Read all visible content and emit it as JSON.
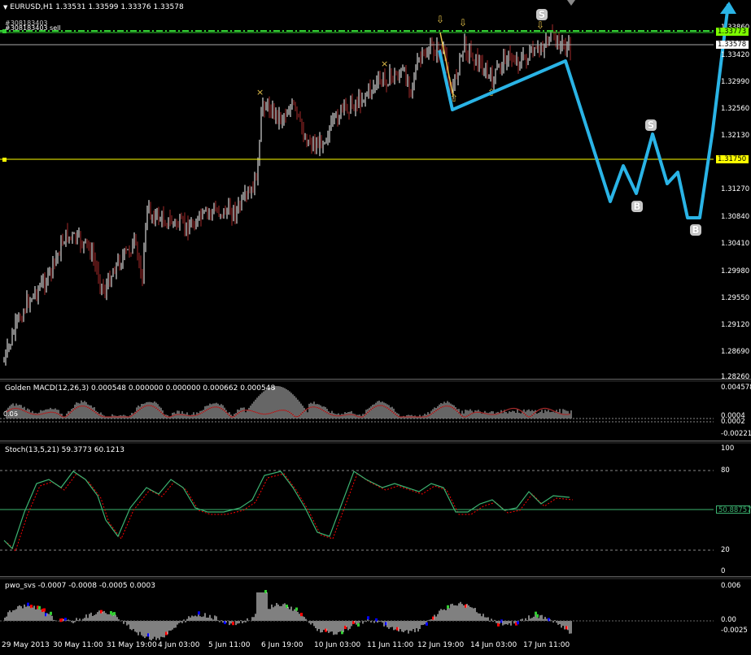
{
  "main": {
    "header": "EURUSD,H1  1.33531 1.33599 1.33376 1.33578",
    "order_label": "#308183403 sell",
    "order_label2": "#308183403",
    "price_ticks": [
      "1.33860",
      "1.33578",
      "1.33420",
      "1.32990",
      "1.32560",
      "1.32130",
      "1.31750",
      "1.31270",
      "1.30840",
      "1.30410",
      "1.29980",
      "1.29550",
      "1.29120",
      "1.28690",
      "1.28260"
    ],
    "order_price": "1.33773",
    "current_price": "1.33578",
    "line_price": "1.31750",
    "pattern_labels": [
      "S",
      "S",
      "B",
      "B"
    ]
  },
  "macd": {
    "header": "Golden MACD(12,26,3) 0.000548 0.000000 0.000000 0.000662 0.000548",
    "ticks": [
      "0.004578",
      "0.0004",
      "0.0002",
      "-0.002211"
    ],
    "left_label": "0.06"
  },
  "stoch": {
    "header": "Stoch(13,5,21) 59.3773 60.1213",
    "ticks": [
      "100",
      "80",
      "20",
      "0"
    ],
    "current": "50.88757"
  },
  "pwo": {
    "header": "pwo_svs -0.0007 -0.0008 -0.0005 0.0003",
    "ticks": [
      "0.006",
      "0.00",
      "-0.0025"
    ]
  },
  "time_axis": [
    "29 May 2013",
    "30 May 11:00",
    "31 May 19:00",
    "4 Jun 03:00",
    "5 Jun 11:00",
    "6 Jun 19:00",
    "10 Jun 03:00",
    "11 Jun 11:00",
    "12 Jun 19:00",
    "14 Jun 03:00",
    "17 Jun 11:00"
  ],
  "colors": {
    "bull": "#ffffff",
    "bear": "#a52a2a",
    "order_line": "#32cd32",
    "hline": "#ffff00",
    "forecast": "#2ab4e6",
    "stoch_main": "#3cb371",
    "stoch_signal": "#ff0000"
  }
}
